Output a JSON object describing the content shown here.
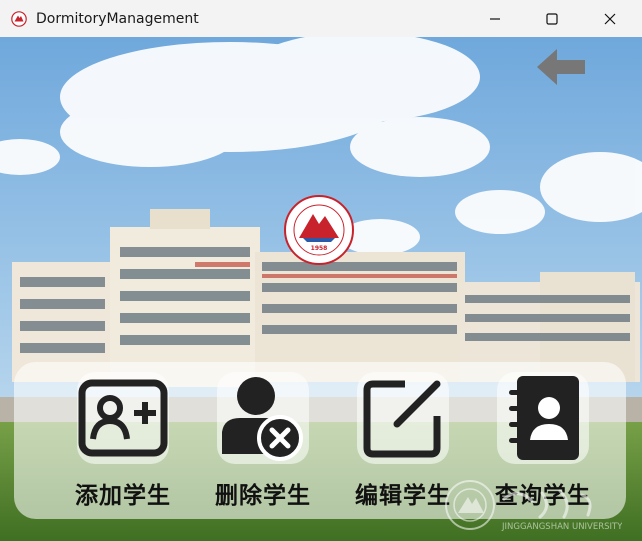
{
  "window": {
    "title": "DormitoryManagement",
    "app_icon": "university-emblem-icon",
    "controls": [
      "minimize-icon",
      "maximize-icon",
      "close-icon"
    ]
  },
  "navigation": {
    "back_icon": "arrow-left-icon",
    "back_color": "#777777"
  },
  "emblem": {
    "year": "1958",
    "ring_text": "JINGGANGSHAN UNIVERSITY"
  },
  "actions": [
    {
      "label": "添加学生",
      "icon": "add-user-icon"
    },
    {
      "label": "删除学生",
      "icon": "delete-user-icon"
    },
    {
      "label": "编辑学生",
      "icon": "edit-icon"
    },
    {
      "label": "查询学生",
      "icon": "contact-book-icon"
    }
  ],
  "watermark": {
    "text": "JINGGANGSHAN UNIVERSITY"
  },
  "colors": {
    "icon_dark": "#222222",
    "emblem_red": "#c8232c",
    "sky": "#7fb4e0"
  }
}
